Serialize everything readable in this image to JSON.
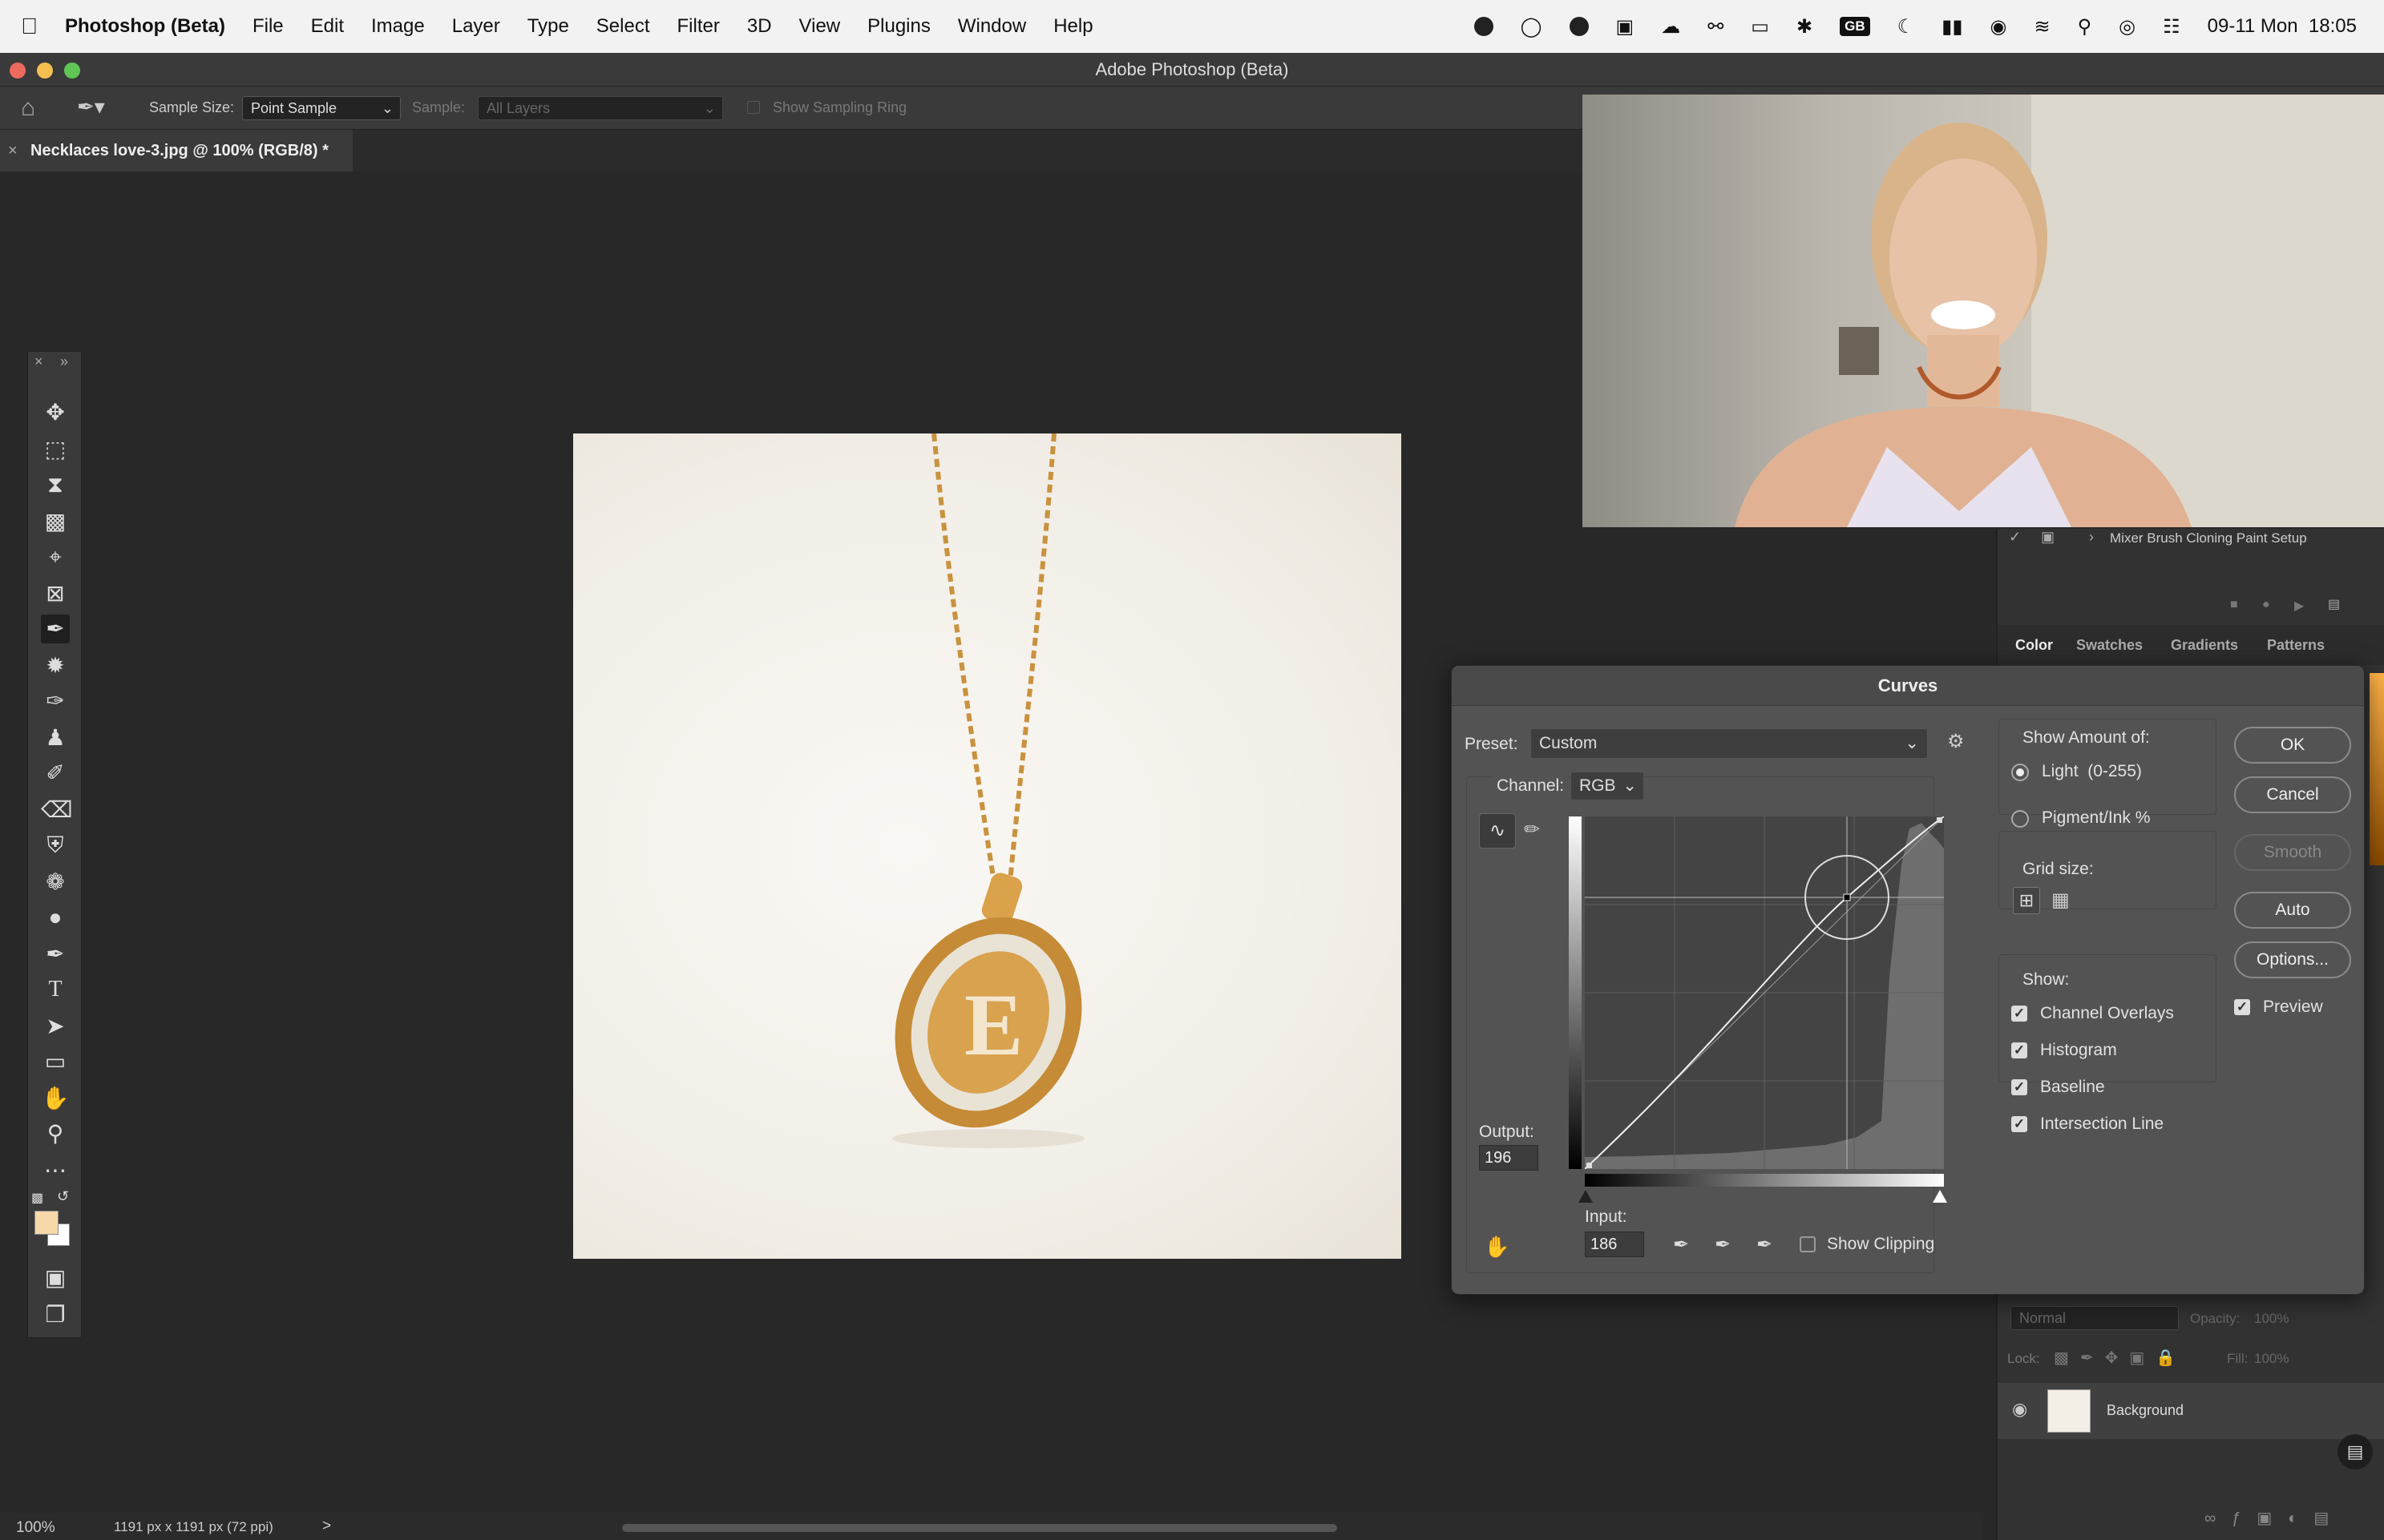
{
  "menubar": {
    "app_name": "Photoshop (Beta)",
    "items": [
      "File",
      "Edit",
      "Image",
      "Layer",
      "Type",
      "Select",
      "Filter",
      "3D",
      "View",
      "Plugins",
      "Window",
      "Help"
    ],
    "clock": "09-11 Mon  18:05",
    "keyboard_badge": "GB"
  },
  "window": {
    "title": "Adobe Photoshop (Beta)"
  },
  "options": {
    "sample_size_label": "Sample Size:",
    "sample_size_value": "Point Sample",
    "sample_label": "Sample:",
    "sample_value": "All Layers",
    "show_sampling_ring": "Show Sampling Ring"
  },
  "document": {
    "tab_title": "Necklaces love-3.jpg @ 100% (RGB/8) *"
  },
  "status": {
    "zoom": "100%",
    "dimensions": "1191 px x 1191 px (72 ppi)",
    "arrow": ">"
  },
  "panels": {
    "actions_item": "Mixer Brush Cloning Paint Setup",
    "tabs": [
      "Color",
      "Swatches",
      "Gradients",
      "Patterns"
    ],
    "blend_mode": "Normal",
    "opacity_label": "Opacity:",
    "opacity_value": "100%",
    "lock_label": "Lock:",
    "fill_label": "Fill:",
    "fill_value": "100%",
    "layer_name": "Background"
  },
  "curves": {
    "title": "Curves",
    "preset_label": "Preset:",
    "preset_value": "Custom",
    "channel_label": "Channel:",
    "channel_value": "RGB",
    "output_label": "Output:",
    "output_value": "196",
    "input_label": "Input:",
    "input_value": "186",
    "show_clipping": "Show Clipping",
    "show_amount_label": "Show Amount of:",
    "light_option": "Light  (0-255)",
    "pigment_option": "Pigment/Ink %",
    "grid_size_label": "Grid size:",
    "show_label": "Show:",
    "channel_overlays": "Channel Overlays",
    "histogram": "Histogram",
    "baseline": "Baseline",
    "intersection_line": "Intersection Line",
    "ok": "OK",
    "cancel": "Cancel",
    "smooth": "Smooth",
    "auto": "Auto",
    "options": "Options...",
    "preview": "Preview"
  }
}
